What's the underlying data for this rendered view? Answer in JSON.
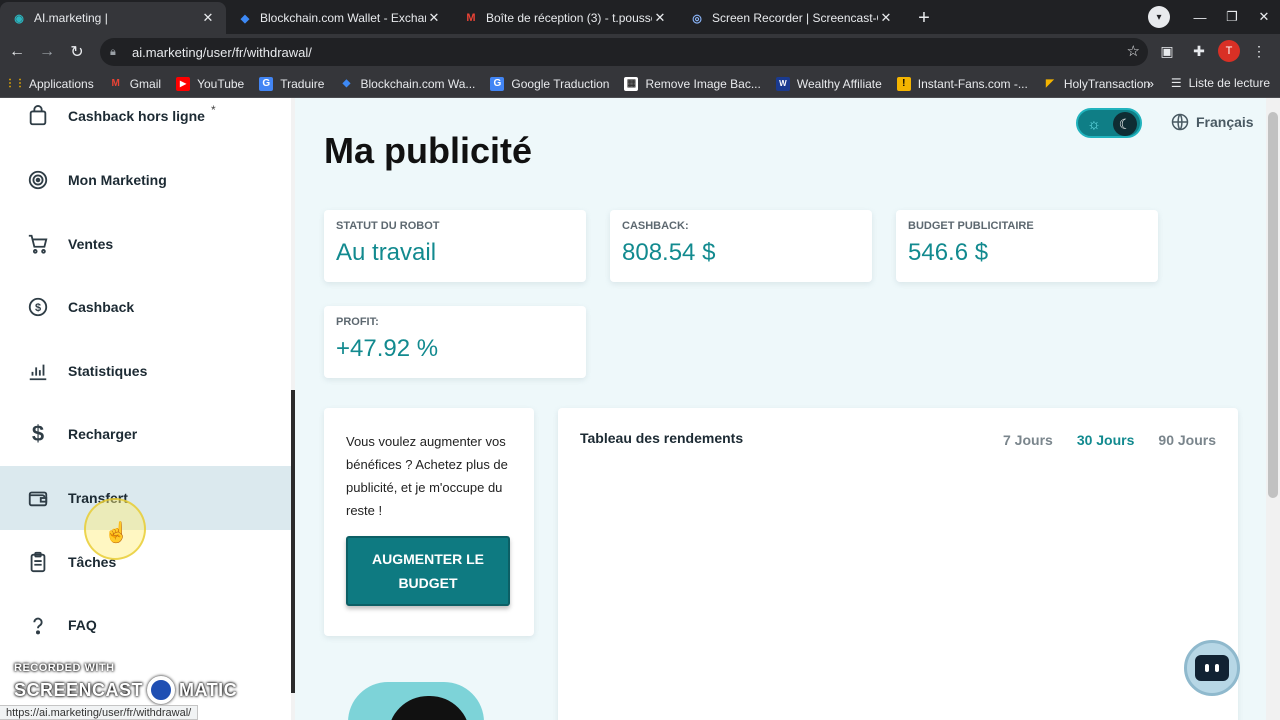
{
  "browser": {
    "tabs": [
      {
        "title": "AI.marketing |",
        "icon": "aimarketing-favicon",
        "active": true
      },
      {
        "title": "Blockchain.com Wallet - Exchang",
        "icon": "blockchain-favicon",
        "active": false
      },
      {
        "title": "Boîte de réception (3) - t.pousse",
        "icon": "gmail-favicon",
        "active": false
      },
      {
        "title": "Screen Recorder | Screencast-O-M",
        "icon": "screencast-favicon",
        "active": false
      }
    ],
    "url": "ai.marketing/user/fr/withdrawal/",
    "avatar_letter": "T",
    "bookmarks": [
      {
        "label": "Applications",
        "icon": "apps-grid-icon"
      },
      {
        "label": "Gmail",
        "icon": "gmail-icon"
      },
      {
        "label": "YouTube",
        "icon": "youtube-icon"
      },
      {
        "label": "Traduire",
        "icon": "translate-icon"
      },
      {
        "label": "Blockchain.com Wa...",
        "icon": "blockchain-icon"
      },
      {
        "label": "Google Traduction",
        "icon": "google-translate-icon"
      },
      {
        "label": "Remove Image Bac...",
        "icon": "removebg-icon"
      },
      {
        "label": "Wealthy Affiliate",
        "icon": "wealthy-affiliate-icon"
      },
      {
        "label": "Instant-Fans.com -...",
        "icon": "instant-fans-icon"
      },
      {
        "label": "HolyTransaction",
        "icon": "holytransaction-icon"
      }
    ],
    "reading_list": "Liste de lecture",
    "status_url": "https://ai.marketing/user/fr/withdrawal/"
  },
  "sidebar": {
    "items": [
      {
        "label": "Cashback hors ligne",
        "icon": "shopping-bag-icon",
        "badge": "*"
      },
      {
        "label": "Mon Marketing",
        "icon": "target-icon"
      },
      {
        "label": "Ventes",
        "icon": "cart-icon"
      },
      {
        "label": "Cashback",
        "icon": "dollar-circle-icon"
      },
      {
        "label": "Statistiques",
        "icon": "bar-chart-icon"
      },
      {
        "label": "Recharger",
        "icon": "dollar-icon"
      },
      {
        "label": "Transfert",
        "icon": "wallet-icon"
      },
      {
        "label": "Tâches",
        "icon": "clipboard-icon"
      },
      {
        "label": "FAQ",
        "icon": "help-icon"
      }
    ],
    "active_index": 6
  },
  "main": {
    "title": "Ma publicité",
    "language": "Français",
    "stats": [
      {
        "label": "STATUT DU ROBOT",
        "value": "Au travail"
      },
      {
        "label": "CASHBACK:",
        "value": "808.54 $"
      },
      {
        "label": "BUDGET PUBLICITAIRE",
        "value": "546.6 $"
      },
      {
        "label": "PROFIT:",
        "value": "+47.92 %"
      }
    ],
    "promo": {
      "text": "Vous voulez augmenter vos bénéfices ? Achetez plus de publicité, et je m'occupe du reste !",
      "button_line1": "AUGMENTER LE",
      "button_line2": "BUDGET"
    },
    "yield": {
      "title": "Tableau des rendements",
      "periods": [
        "7 Jours",
        "30 Jours",
        "90 Jours"
      ],
      "selected_period": "30 Jours"
    }
  },
  "recorder": {
    "line1": "RECORDED WITH",
    "word1": "SCREENCAST",
    "word2": "MATIC"
  },
  "colors": {
    "accent": "#128a8f",
    "button": "#0e7a81",
    "page_bg": "#eef8fa",
    "active_item_bg": "#dbe9ee"
  }
}
